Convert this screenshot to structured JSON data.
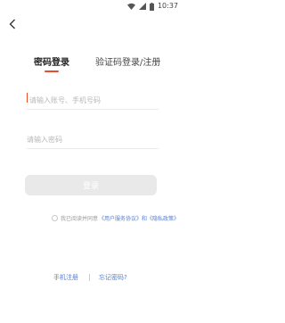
{
  "status_bar": {
    "time": "10:37",
    "icons": [
      "wifi-icon",
      "signal-icon",
      "battery-icon"
    ]
  },
  "nav": {
    "back_icon": "back-chevron-icon"
  },
  "tabs": [
    {
      "label": "密码登录",
      "active": true
    },
    {
      "label": "验证码登录/注册",
      "active": false
    }
  ],
  "form": {
    "account_placeholder": "请输入账号、手机号码",
    "password_placeholder": "请输入密码",
    "login_label": "登录"
  },
  "agreement": {
    "text": "我已阅读并同意",
    "links": "《用户服务协议》和《隐私政策》"
  },
  "footer": {
    "register_label": "手机注册",
    "forgot_label": "忘记密码?"
  },
  "colors": {
    "accent": "#e94e2c",
    "link": "#5a7ec8",
    "button_disabled": "#e9e9e9"
  }
}
